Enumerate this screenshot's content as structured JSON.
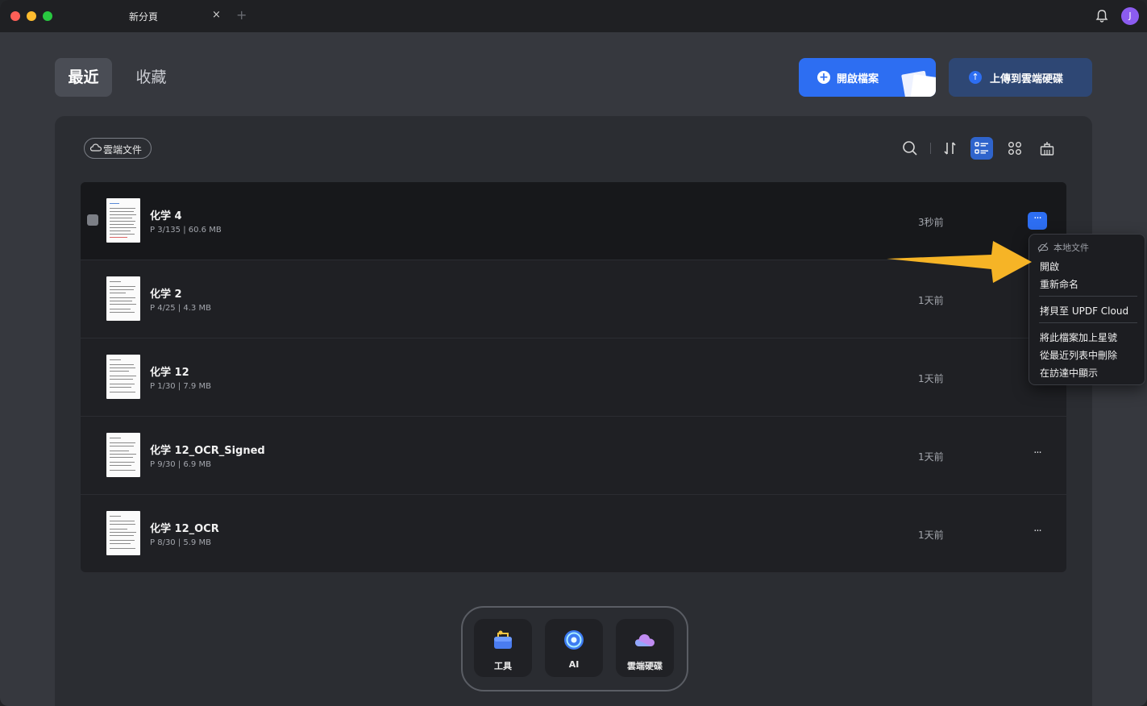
{
  "tab": {
    "title": "新分頁",
    "close": "×",
    "new": "+"
  },
  "user": {
    "avatar_initial": "J"
  },
  "segments": {
    "recent": "最近",
    "favorites": "收藏"
  },
  "actions": {
    "open_file": "開啟檔案",
    "upload_cloud": "上傳到雲端硬碟"
  },
  "filter_chip": "雲端文件",
  "toolbar": {
    "icons": [
      "search-icon",
      "sort-icon",
      "list-view-icon",
      "grid-view-icon",
      "clear-icon"
    ],
    "active": "list-view-icon"
  },
  "files": [
    {
      "name": "化学 4",
      "meta": "P 3/135 | 60.6 MB",
      "time": "3秒前",
      "selected": true
    },
    {
      "name": "化学 2",
      "meta": "P 4/25 | 4.3 MB",
      "time": "1天前"
    },
    {
      "name": "化学 12",
      "meta": "P 1/30 | 7.9 MB",
      "time": "1天前"
    },
    {
      "name": "化学 12_OCR_Signed",
      "meta": "P 9/30 | 6.9 MB",
      "time": "1天前"
    },
    {
      "name": "化学 12_OCR",
      "meta": "P 8/30 | 5.9 MB",
      "time": "1天前"
    }
  ],
  "more_label": "···",
  "context_menu": {
    "header": "本地文件",
    "items": [
      "開啟",
      "重新命名",
      "拷貝至 UPDF Cloud",
      "將此檔案加上星號",
      "從最近列表中刪除",
      "在訪達中顯示"
    ]
  },
  "dock": {
    "tools": "工具",
    "ai": "AI",
    "cloud": "雲端硬碟"
  },
  "colors": {
    "accent": "#2d6ef2",
    "arrow": "#f6b426",
    "background": "#36383e"
  }
}
